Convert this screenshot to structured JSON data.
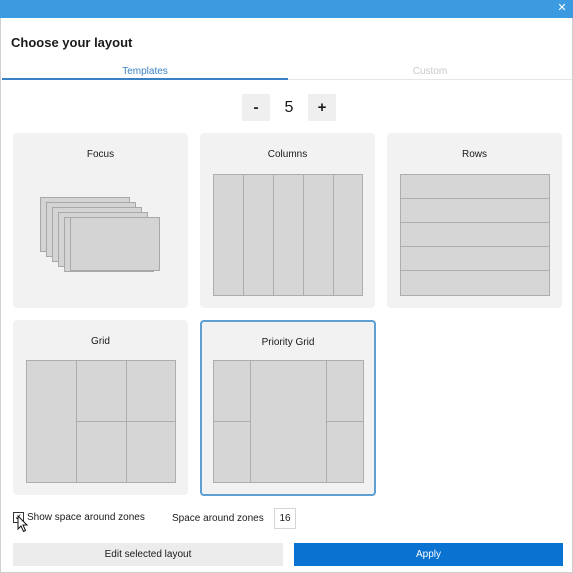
{
  "window": {
    "close_glyph": "✕"
  },
  "dialog": {
    "title": "Choose your layout"
  },
  "tabs": [
    {
      "label": "Templates",
      "selected": true
    },
    {
      "label": "Custom",
      "selected": false
    }
  ],
  "zone_count": {
    "decrement_label": "-",
    "value": "5",
    "increment_label": "+"
  },
  "layouts": [
    {
      "label": "Focus",
      "selected": false
    },
    {
      "label": "Columns",
      "selected": false
    },
    {
      "label": "Rows",
      "selected": false
    },
    {
      "label": "Grid",
      "selected": false
    },
    {
      "label": "Priority Grid",
      "selected": true
    }
  ],
  "options": {
    "show_space_label": "Show space around zones",
    "show_space_checked": true,
    "check_glyph": "✓",
    "space_label": "Space around zones",
    "space_value": "16"
  },
  "actions": {
    "edit_label": "Edit selected layout",
    "apply_label": "Apply"
  },
  "colors": {
    "titlebar": "#3c9be0",
    "accent": "#3b82c4",
    "apply": "#0a72d1",
    "selected_border": "#5e9fd4"
  }
}
